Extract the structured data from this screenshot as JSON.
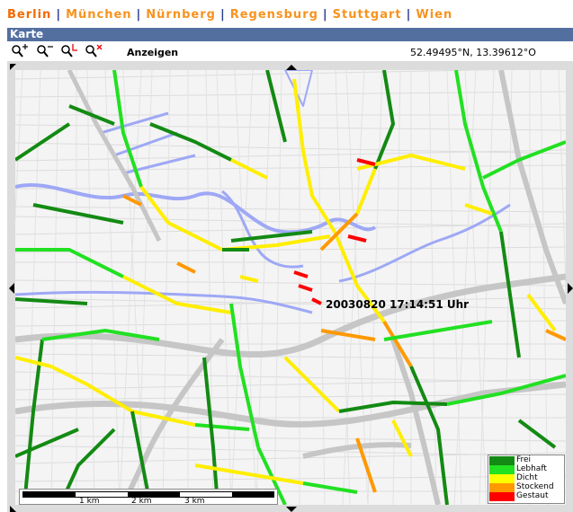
{
  "cities": [
    {
      "label": "Berlin",
      "active": true
    },
    {
      "label": "München",
      "active": false
    },
    {
      "label": "Nürnberg",
      "active": false
    },
    {
      "label": "Regensburg",
      "active": false
    },
    {
      "label": "Stuttgart",
      "active": false
    },
    {
      "label": "Wien",
      "active": false
    }
  ],
  "separator": "|",
  "panel": {
    "title": "Karte"
  },
  "toolbar": {
    "tools": [
      {
        "icon": "zoom-in-icon"
      },
      {
        "icon": "zoom-out-icon"
      },
      {
        "icon": "zoom-reset-icon"
      },
      {
        "icon": "zoom-cancel-icon"
      }
    ],
    "show_label": "Anzeigen",
    "coordinates": "52.49495°N, 13.39612°O"
  },
  "map": {
    "timestamp": "20030820  17:14:51 Uhr",
    "legend": [
      {
        "label": "Frei",
        "color": "#138a13"
      },
      {
        "label": "Lebhaft",
        "color": "#22e022"
      },
      {
        "label": "Dicht",
        "color": "#ffff00"
      },
      {
        "label": "Stockend",
        "color": "#ff9900"
      },
      {
        "label": "Gestaut",
        "color": "#ff0000"
      }
    ],
    "scale": {
      "labels": [
        "1 km",
        "2 km",
        "3 km"
      ]
    },
    "colors": {
      "frei": "#138a13",
      "lebhaft": "#22e022",
      "dicht": "#ffee00",
      "stockend": "#ff9900",
      "gestaut": "#ff0000",
      "water": "#9ea8f5",
      "road": "#c6c6c6"
    }
  }
}
